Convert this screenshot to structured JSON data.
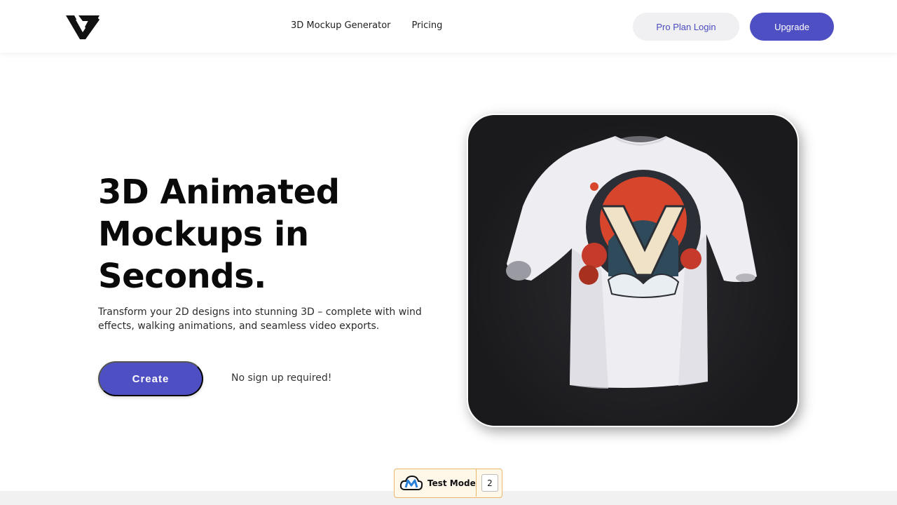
{
  "navbar": {
    "logo_name": "brand-logo",
    "links": [
      "3D Mockup Generator",
      "Pricing"
    ],
    "login_label": "Pro Plan Login",
    "upgrade_label": "Upgrade"
  },
  "hero": {
    "title_lines": [
      "3D Animated",
      "Mockups in",
      "Seconds."
    ],
    "description_lines": [
      "Transform your 2D designs into stunning 3D – complete with wind",
      "effects, walking animations, and seamless video exports."
    ],
    "create_label": "Create",
    "no_signup_text": "No sign up required!"
  },
  "mockup": {
    "image_desc": "white-tshirt-3d-mockup"
  },
  "test_mode": {
    "label": "Test Mode",
    "count": "2"
  },
  "colors": {
    "accent": "#4f4fc4",
    "login_bg": "#f0f0f2",
    "badge_border": "#e9b86c"
  }
}
